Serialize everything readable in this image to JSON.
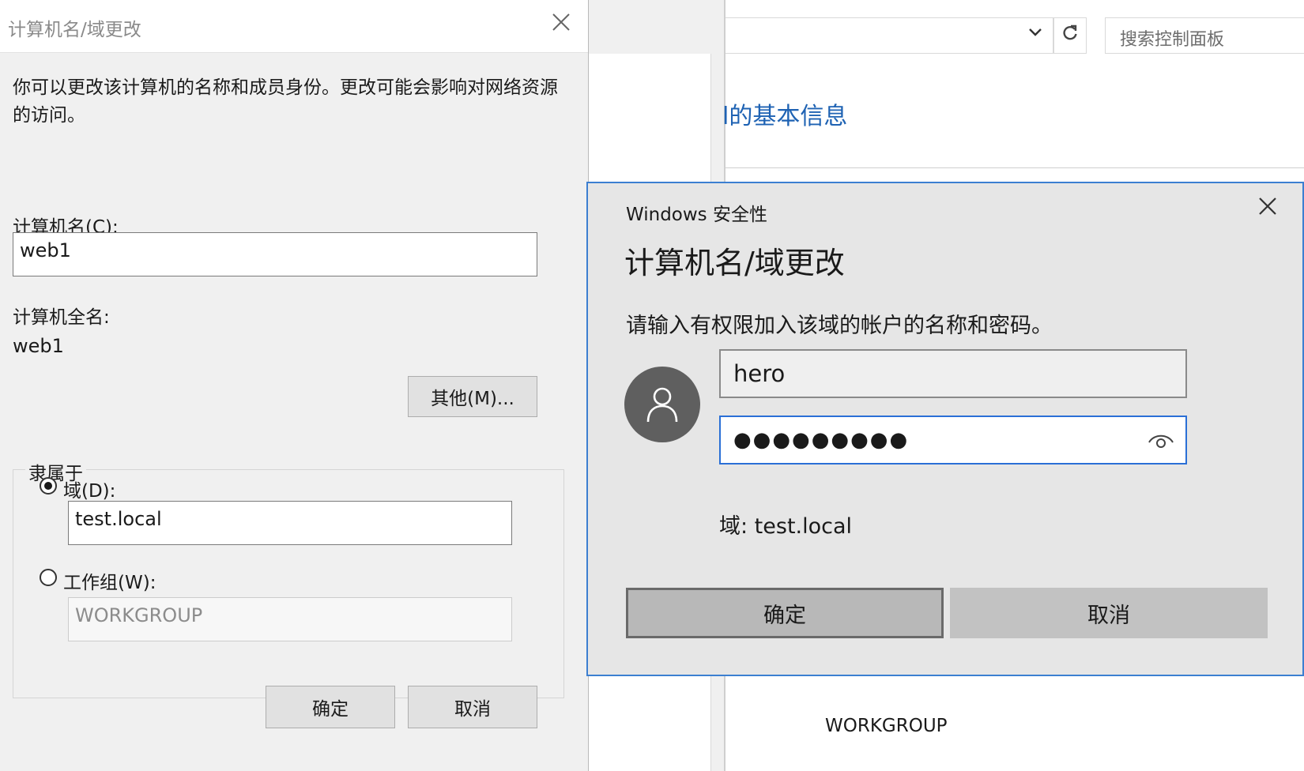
{
  "background": {
    "search_placeholder": "搜索控制面板",
    "heading": "l的基本信息",
    "workgroup_value": "WORKGROUP",
    "refresh_icon": "refresh-icon",
    "chevron_icon": "chevron-down-icon"
  },
  "left_dialog": {
    "title": "计算机名/域更改",
    "description": "你可以更改该计算机的名称和成员身份。更改可能会影响对网络资源的访问。",
    "computer_name_label": "计算机名(C):",
    "computer_name_value": "web1",
    "full_name_label": "计算机全名:",
    "full_name_value": "web1",
    "more_button": "其他(M)...",
    "member_of_label": "隶属于",
    "domain_radio_label": "域(D):",
    "domain_value": "test.local",
    "workgroup_radio_label": "工作组(W):",
    "workgroup_value": "WORKGROUP",
    "ok_button": "确定",
    "cancel_button": "取消",
    "selected_membership": "domain"
  },
  "security_dialog": {
    "caption": "Windows 安全性",
    "title": "计算机名/域更改",
    "prompt": "请输入有权限加入该域的帐户的名称和密码。",
    "username_value": "hero",
    "password_masked": "●●●●●●●●●",
    "domain_text": "域: test.local",
    "ok_button": "确定",
    "cancel_button": "取消",
    "accent_color": "#3c7fd1"
  }
}
